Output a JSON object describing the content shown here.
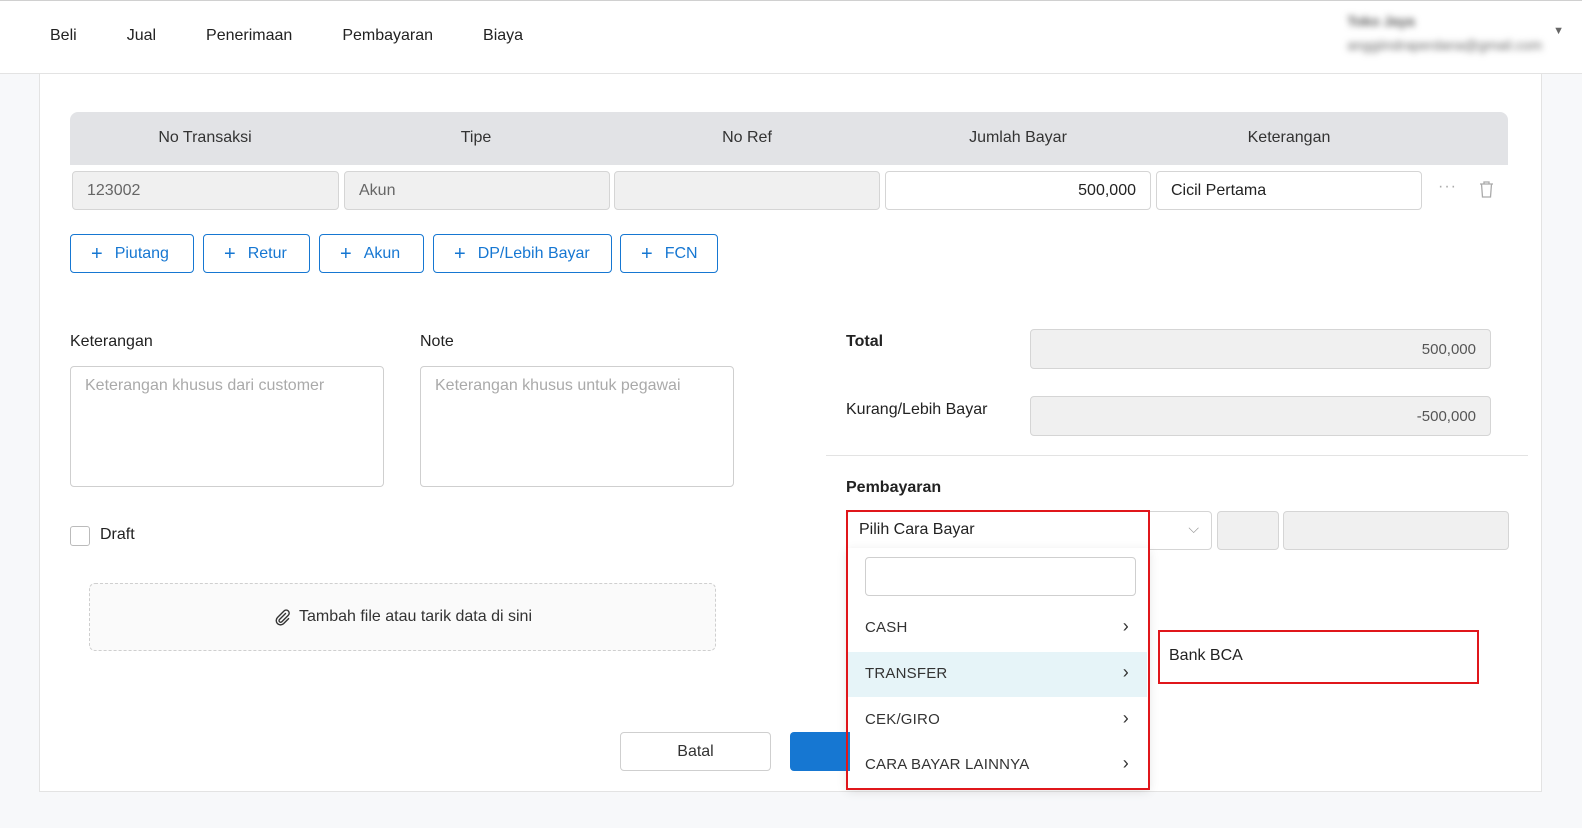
{
  "nav": {
    "items": [
      "Beli",
      "Jual",
      "Penerimaan",
      "Pembayaran",
      "Biaya"
    ]
  },
  "user": {
    "name": "Toko Jaya",
    "email": "anggiindraperdana@gmail.com"
  },
  "table": {
    "headers": [
      "No Transaksi",
      "Tipe",
      "No Ref",
      "Jumlah Bayar",
      "Keterangan"
    ],
    "row": {
      "no_transaksi": "123002",
      "tipe": "Akun",
      "no_ref": "",
      "jumlah_bayar": "500,000",
      "keterangan": "Cicil Pertama"
    }
  },
  "add_buttons": [
    "Piutang",
    "Retur",
    "Akun",
    "DP/Lebih Bayar",
    "FCN"
  ],
  "keterangan": {
    "label": "Keterangan",
    "placeholder": "Keterangan khusus dari customer"
  },
  "note": {
    "label": "Note",
    "placeholder": "Keterangan khusus untuk pegawai"
  },
  "draft": {
    "label": "Draft",
    "checked": false
  },
  "dropzone": {
    "text": "Tambah file atau tarik data di sini"
  },
  "summary": {
    "total_label": "Total",
    "total_value": "500,000",
    "kurang_label": "Kurang/Lebih Bayar",
    "kurang_value": "-500,000"
  },
  "payment": {
    "label": "Pembayaran",
    "select_placeholder": "Pilih Cara Bayar",
    "options": [
      "CASH",
      "TRANSFER",
      "CEK/GIRO",
      "CARA BAYAR LAINNYA"
    ],
    "active_option": "TRANSFER",
    "submenu": [
      "Bank BCA"
    ]
  },
  "footer": {
    "cancel_label": "Batal"
  },
  "colors": {
    "primary": "#1677d2",
    "highlight": "#e0161b",
    "active_row": "#e6f4f8"
  }
}
